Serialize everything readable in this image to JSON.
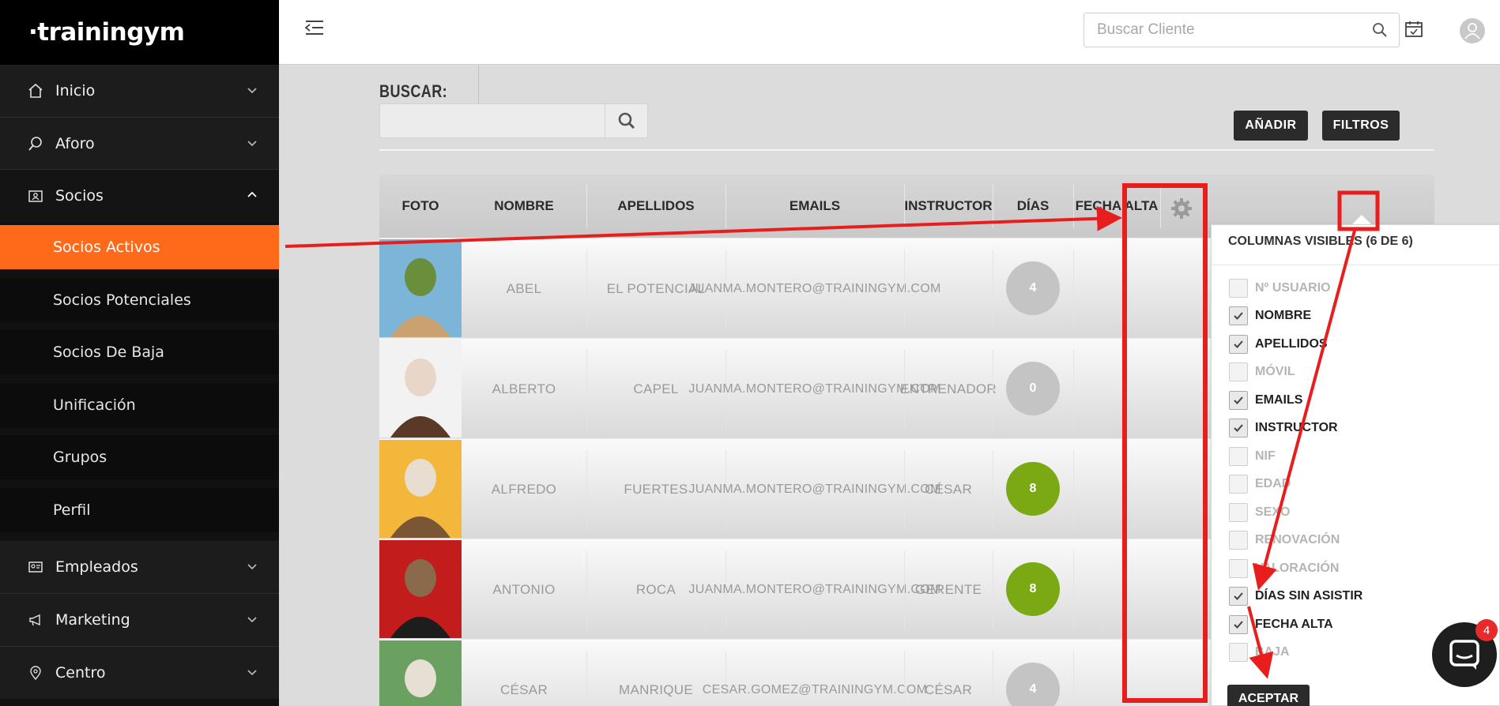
{
  "app": {
    "logo": "·trainingym"
  },
  "sidebar": {
    "items": [
      {
        "label": "Inicio",
        "icon": "home-icon"
      },
      {
        "label": "Aforo",
        "icon": "search-icon"
      },
      {
        "label": "Socios",
        "icon": "id-card-icon"
      }
    ],
    "subitems": [
      {
        "label": "Socios Activos",
        "active": true
      },
      {
        "label": "Socios Potenciales"
      },
      {
        "label": "Socios De Baja"
      },
      {
        "label": "Unificación"
      },
      {
        "label": "Grupos"
      },
      {
        "label": "Perfil"
      }
    ],
    "bottom_items": [
      {
        "label": "Empleados",
        "icon": "contact-card-icon"
      },
      {
        "label": "Marketing",
        "icon": "megaphone-icon"
      },
      {
        "label": "Centro",
        "icon": "location-pin-icon"
      }
    ]
  },
  "topbar": {
    "search_placeholder": "Buscar Cliente"
  },
  "search": {
    "label": "BUSCAR:"
  },
  "buttons": {
    "add": "AÑADIR",
    "filters": "FILTROS"
  },
  "table": {
    "headers": [
      "FOTO",
      "NOMBRE",
      "APELLIDOS",
      "EMAILS",
      "INSTRUCTOR",
      "DÍAS",
      "FECHA ALTA"
    ],
    "rows": [
      {
        "nombre": "ABEL",
        "apellidos": "EL POTENCIAL",
        "email": "JUANMA.MONTERO@TRAININGYM.COM",
        "instructor": "",
        "dias": "4",
        "dias_color": "#c4c4c4"
      },
      {
        "nombre": "ALBERTO",
        "apellidos": "CAPEL",
        "email": "JUANMA.MONTERO@TRAININGYM.COM",
        "instructor": "ENTRENADOR",
        "dias": "0",
        "dias_color": "#c4c4c4"
      },
      {
        "nombre": "ALFREDO",
        "apellidos": "FUERTES",
        "email": "JUANMA.MONTERO@TRAININGYM.COM",
        "instructor": "CÉSAR",
        "dias": "8",
        "dias_color": "#7aa913"
      },
      {
        "nombre": "ANTONIO",
        "apellidos": "ROCA",
        "email": "JUANMA.MONTERO@TRAININGYM.COM",
        "instructor": "GERENTE",
        "dias": "8",
        "dias_color": "#7aa913"
      },
      {
        "nombre": "CÉSAR",
        "apellidos": "MANRIQUE",
        "email": "CESAR.GOMEZ@TRAININGYM.COM",
        "instructor": "CÉSAR",
        "dias": "4",
        "dias_color": "#c4c4c4"
      }
    ]
  },
  "column_selector": {
    "title": "COLUMNAS VISIBLES (6 DE 6)",
    "options": [
      {
        "label": "Nº USUARIO",
        "checked": false
      },
      {
        "label": "NOMBRE",
        "checked": true
      },
      {
        "label": "APELLIDOS",
        "checked": true
      },
      {
        "label": "MÓVIL",
        "checked": false
      },
      {
        "label": "EMAILS",
        "checked": true
      },
      {
        "label": "INSTRUCTOR",
        "checked": true
      },
      {
        "label": "NIF",
        "checked": false
      },
      {
        "label": "EDAD",
        "checked": false
      },
      {
        "label": "SEXO",
        "checked": false
      },
      {
        "label": "RENOVACIÓN",
        "checked": false
      },
      {
        "label": "VALORACIÓN",
        "checked": false
      },
      {
        "label": "DÍAS SIN ASISTIR",
        "checked": true
      },
      {
        "label": "FECHA ALTA",
        "checked": true
      },
      {
        "label": "BAJA",
        "checked": false
      }
    ],
    "accept": "ACEPTAR"
  },
  "chat": {
    "badge": "4"
  },
  "colors": {
    "accent": "#ff6a1a",
    "annotation": "#e81e1e",
    "badge_green": "#7aa913",
    "badge_grey": "#c4c4c4"
  }
}
